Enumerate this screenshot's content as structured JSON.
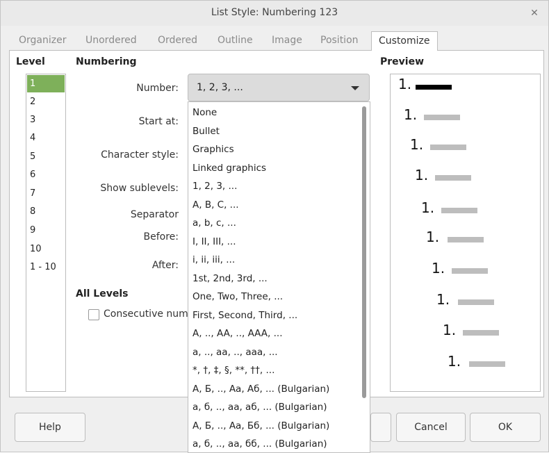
{
  "window": {
    "title": "List Style: Numbering 123"
  },
  "tabs": [
    "Organizer",
    "Unordered",
    "Ordered",
    "Outline",
    "Image",
    "Position",
    "Customize"
  ],
  "active_tab": "Customize",
  "level_section": {
    "heading": "Level",
    "items": [
      "1",
      "2",
      "3",
      "4",
      "5",
      "6",
      "7",
      "8",
      "9",
      "10",
      "1 - 10"
    ],
    "selected": "1"
  },
  "numbering": {
    "heading": "Numbering",
    "number_label": "Number:",
    "number_value": "1, 2, 3, ...",
    "start_at_label": "Start at:",
    "char_style_label": "Character style:",
    "show_sublevels_label": "Show sublevels:",
    "separator_label": "Separator",
    "before_label": "Before:",
    "after_label": "After:"
  },
  "dropdown_options": [
    "None",
    "Bullet",
    "Graphics",
    "Linked graphics",
    "1, 2, 3, ...",
    "A, B, C, ...",
    "a, b, c, ...",
    "I, II, III, ...",
    "i, ii, iii, ...",
    "1st, 2nd, 3rd, ...",
    "One, Two, Three, ...",
    "First, Second, Third, ...",
    "A, .., AA, .., AAA, ...",
    "a, .., aa, .., aaa, ...",
    "*, †, ‡, §, **, ††, ...",
    "А, Б, .., Аа, Аб, ... (Bulgarian)",
    "а, б, .., аа, аб, ... (Bulgarian)",
    "А, Б, .., Аа, Бб, ... (Bulgarian)",
    "а, б, .., аа, бб, ... (Bulgarian)"
  ],
  "all_levels": {
    "heading": "All Levels",
    "consecutive_label": "Consecutive num",
    "consecutive_checked": false
  },
  "preview": {
    "heading": "Preview",
    "numbers": [
      "1.",
      "1.",
      "1.",
      "1.",
      "1.",
      "1.",
      "1.",
      "1.",
      "1.",
      "1."
    ]
  },
  "buttons": {
    "help": "Help",
    "cancel": "Cancel",
    "ok": "OK"
  }
}
